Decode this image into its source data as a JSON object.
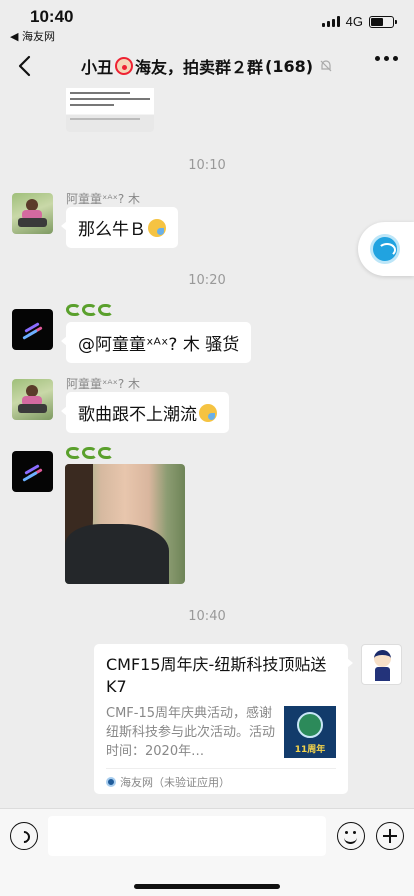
{
  "status": {
    "time": "10:40",
    "back_app": "◀ 海友网",
    "network": "4G"
  },
  "nav": {
    "title_prefix": "小丑",
    "title_suffix": "海友，拍卖群２群",
    "member_count": "(168)"
  },
  "chat": {
    "timestamps": [
      "10:10",
      "10:20",
      "10:40"
    ],
    "messages": [
      {
        "sender": "阿童童ˣᴬˣ? 木",
        "text": "那么牛Ｂ"
      },
      {
        "text": "@阿童童ˣᴬˣ? 木 骚货"
      },
      {
        "sender": "阿童童ˣᴬˣ? 木",
        "text": "歌曲跟不上潮流"
      }
    ],
    "link_card": {
      "title": "CMF15周年庆-纽斯科技顶贴送K7",
      "description": "CMF-15周年庆典活动，感谢纽斯科技参与此次活动。活动时间：2020年…",
      "thumb_label": "11周年",
      "source": "海友网（未验证应用）"
    }
  },
  "input": {
    "placeholder": ""
  }
}
